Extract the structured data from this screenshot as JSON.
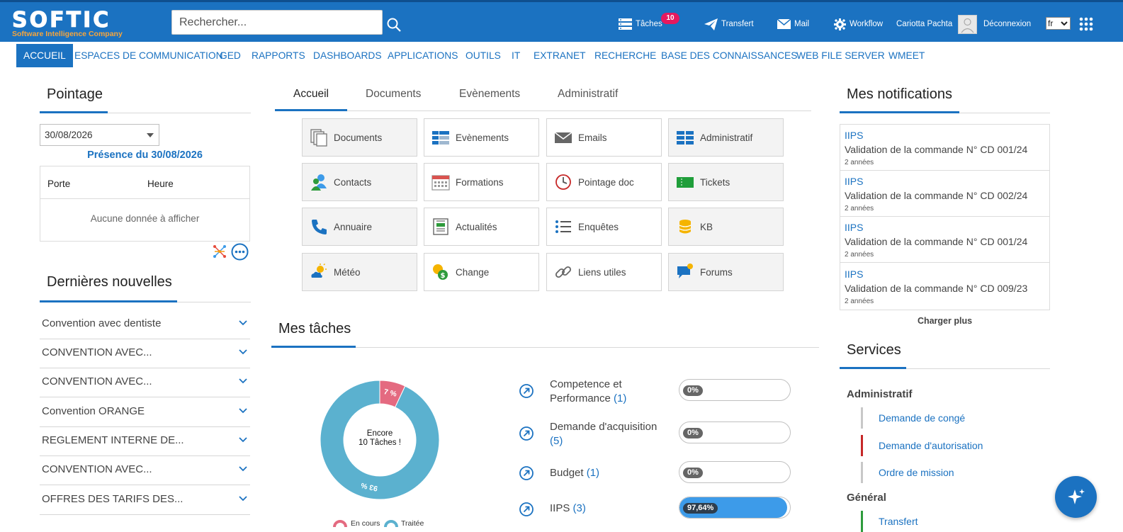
{
  "colors": {
    "brand": "#1b72c1",
    "accent_orange": "#f7a53b",
    "badge": "#e6195f",
    "donut_traitee": "#5bb1cf",
    "donut_en_cours": "#e46a80",
    "progress_fill": "#3d9be9"
  },
  "header": {
    "logo_text": "SOFTIC",
    "logo_sub": "Software Intelligence Company",
    "search_placeholder": "Rechercher...",
    "taches_label": "Tâches",
    "taches_badge": "10",
    "transfert_label": "Transfert",
    "mail_label": "Mail",
    "workflow_label": "Workflow",
    "user_name": "Cariotta Pachta",
    "logout_label": "Déconnexion",
    "lang_value": "fr"
  },
  "nav": {
    "items": [
      "ACCUEIL",
      "ESPACES DE COMMUNICATION",
      "GED",
      "RAPPORTS",
      "DASHBOARDS",
      "APPLICATIONS",
      "OUTILS",
      "IT",
      "EXTRANET",
      "RECHERCHE",
      "BASE DES CONNAISSANCES",
      "WEB FILE SERVER",
      "WMEET"
    ]
  },
  "pointage": {
    "title": "Pointage",
    "date_value": "30/08/2026",
    "presence_title": "Présence du 30/08/2026",
    "col_porte": "Porte",
    "col_heure": "Heure",
    "empty_text": "Aucune donnée à afficher"
  },
  "news": {
    "title": "Dernières nouvelles",
    "items": [
      "Convention avec dentiste",
      "CONVENTION AVEC...",
      "CONVENTION AVEC...",
      "Convention ORANGE",
      "REGLEMENT INTERNE DE...",
      "CONVENTION AVEC...",
      "OFFRES DES TARIFS DES..."
    ]
  },
  "tabs": [
    "Accueil",
    "Documents",
    "Evènements",
    "Administratif"
  ],
  "tiles": {
    "documents": "Documents",
    "evenements": "Evènements",
    "emails": "Emails",
    "administratif": "Administratif",
    "contacts": "Contacts",
    "formations": "Formations",
    "pointage_doc": "Pointage doc",
    "tickets": "Tickets",
    "annuaire": "Annuaire",
    "actualites": "Actualités",
    "enquetes": "Enquêtes",
    "kb": "KB",
    "meteo": "Météo",
    "change": "Change",
    "liens_utiles": "Liens utiles",
    "forums": "Forums"
  },
  "taches": {
    "title": "Mes tâches",
    "donut_center_line1": "Encore",
    "donut_center_line2": "10 Tâches !",
    "legend_en_cours": "En cours",
    "legend_traitee": "Traitée",
    "rows": [
      {
        "label": "Competence et Performance",
        "count": "(1)",
        "pct_text": "0%",
        "pct": 0
      },
      {
        "label": "Demande d'acquisition",
        "count": "(5)",
        "pct_text": "0%",
        "pct": 0
      },
      {
        "label": "Budget",
        "count": "(1)",
        "pct_text": "0%",
        "pct": 0
      },
      {
        "label": "IIPS",
        "count": "(3)",
        "pct_text": "97,64%",
        "pct": 97.64
      }
    ]
  },
  "chart_data": {
    "type": "pie",
    "categories": [
      "En cours",
      "Traitée"
    ],
    "values": [
      7,
      93
    ],
    "slice_labels": [
      "7 %",
      "93 %"
    ]
  },
  "notifications": {
    "title": "Mes notifications",
    "items": [
      {
        "source": "IIPS",
        "message": "Validation de la commande N° CD 001/24",
        "age": "2 années"
      },
      {
        "source": "IIPS",
        "message": "Validation de la commande N° CD 002/24",
        "age": "2 années"
      },
      {
        "source": "IIPS",
        "message": "Validation de la commande N° CD 001/24",
        "age": "2 années"
      },
      {
        "source": "IIPS",
        "message": "Validation de la commande N° CD 009/23",
        "age": "2 années"
      }
    ],
    "load_more": "Charger plus"
  },
  "services": {
    "title": "Services",
    "group_administratif": "Administratif",
    "group_general": "Général",
    "items": [
      {
        "label": "Demande de congé",
        "color": "#c8c8c8"
      },
      {
        "label": "Demande d'autorisation",
        "color": "#c62828"
      },
      {
        "label": "Ordre de mission",
        "color": "#c8c8c8"
      },
      {
        "label": "Transfert",
        "color": "#2e9b3c"
      }
    ]
  }
}
